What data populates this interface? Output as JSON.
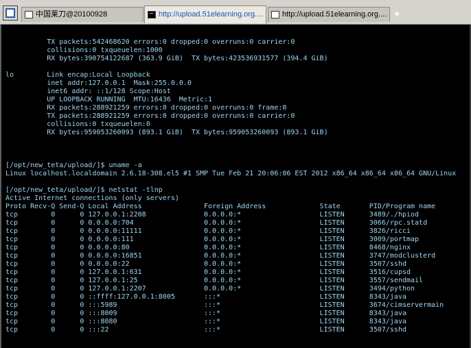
{
  "tabs": [
    {
      "label": "中国莱刀@20100928",
      "active": false,
      "icon": "page-icon"
    },
    {
      "label": "http://upload.51elearning.org....",
      "active": true,
      "icon": "terminal-icon"
    },
    {
      "label": "http://upload.51elearning.org....",
      "active": false,
      "icon": "page-icon"
    }
  ],
  "new_tab_label": "+",
  "terminal": {
    "block1": [
      "          TX packets:542468620 errors:0 dropped:0 overruns:0 carrier:0",
      "          collisions:0 txqueuelen:1000",
      "          RX bytes:390754122687 (363.9 GiB)  TX bytes:423536931577 (394.4 GiB)"
    ],
    "block2": [
      "lo        Link encap:Local Loopback",
      "          inet addr:127.0.0.1  Mask:255.0.0.0",
      "          inet6 addr: ::1/128 Scope:Host",
      "          UP LOOPBACK RUNNING  MTU:16436  Metric:1",
      "          RX packets:288921259 errors:0 dropped:0 overruns:0 frame:0",
      "          TX packets:288921259 errors:0 dropped:0 overruns:0 carrier:0",
      "          collisions:0 txqueuelen:0",
      "          RX bytes:959053260093 (893.1 GiB)  TX bytes:959053260093 (893.1 GiB)"
    ],
    "block3": [
      "[/opt/new_teta/upload/]$ uname -a",
      "Linux localhost.localdomain 2.6.18-308.el5 #1 SMP Tue Feb 21 20:06:06 EST 2012 x86_64 x86_64 x86_64 GNU/Linux"
    ],
    "block4": [
      "[/opt/new_teta/upload/]$ netstat -tlnp",
      "Active Internet connections (only servers)",
      "Proto Recv-Q Send-Q Local Address               Foreign Address             State       PID/Program name",
      "tcp        0      0 127.0.0.1:2208              0.0.0.0:*                   LISTEN      3489/./hpiod",
      "tcp        0      0 0.0.0.0:704                 0.0.0.0:*                   LISTEN      3066/rpc.statd",
      "tcp        0      0 0.0.0.0:11111               0.0.0.0:*                   LISTEN      3826/ricci",
      "tcp        0      0 0.0.0.0:111                 0.0.0.0:*                   LISTEN      3009/portmap",
      "tcp        0      0 0.0.0.0:80                  0.0.0.0:*                   LISTEN      8468/nginx",
      "tcp        0      0 0.0.0.0:16851               0.0.0.0:*                   LISTEN      3747/modclusterd",
      "tcp        0      0 0.0.0.0:22                  0.0.0.0:*                   LISTEN      3507/sshd",
      "tcp        0      0 127.0.0.1:631               0.0.0.0:*                   LISTEN      3516/cupsd",
      "tcp        0      0 127.0.0.1:25                0.0.0.0:*                   LISTEN      3557/sendmail",
      "tcp        0      0 127.0.0.1:2207              0.0.0.0:*                   LISTEN      3494/python",
      "tcp        0      0 ::ffff:127.0.0.1:8005       :::*                        LISTEN      8343/java",
      "tcp        0      0 :::5989                     :::*                        LISTEN      3674/cimservermain",
      "tcp        0      0 :::8009                     :::*                        LISTEN      8343/java",
      "tcp        0      0 :::8080                     :::*                        LISTEN      8343/java",
      "tcp        0      0 :::22                       :::*                        LISTEN      3507/sshd"
    ]
  },
  "colors": {
    "terminal_bg": "#000000",
    "terminal_text": "#9fd7f4",
    "tabbar_bg": "#d6d3ce",
    "active_tab_text": "#1a56b0"
  }
}
